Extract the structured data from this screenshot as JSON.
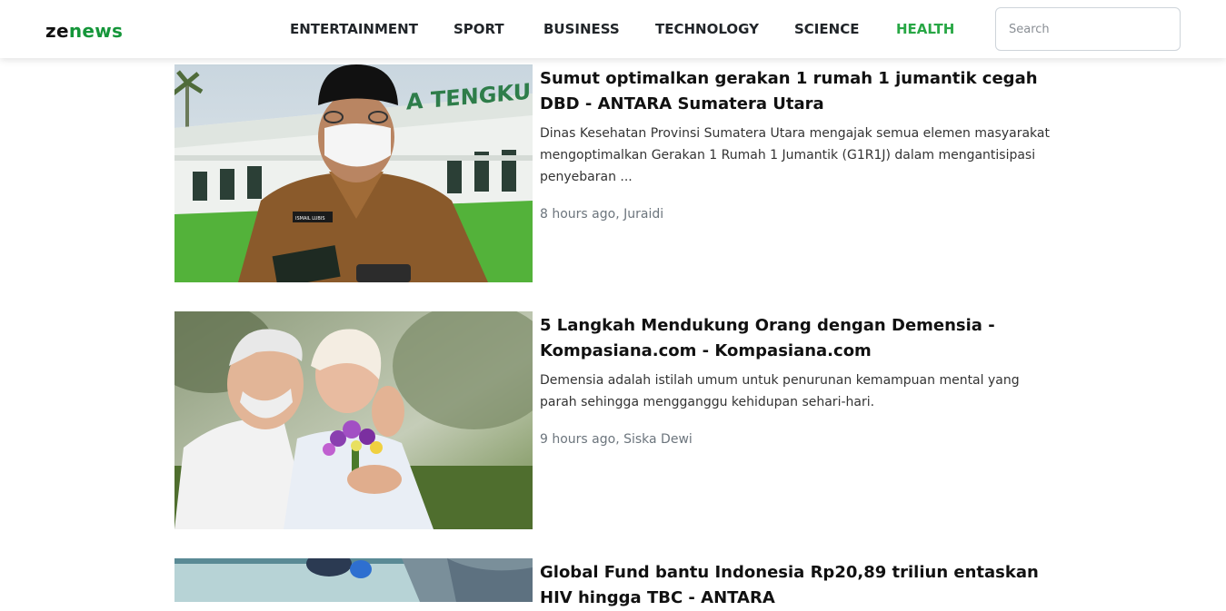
{
  "brand": {
    "part1": "ze",
    "part2": "news",
    "color_dark": "#111111",
    "color_accent": "#15963a"
  },
  "nav": {
    "items": [
      {
        "label": "ENTERTAINMENT",
        "active": false
      },
      {
        "label": "SPORT",
        "active": false
      },
      {
        "label": "BUSINESS",
        "active": false
      },
      {
        "label": "TECHNOLOGY",
        "active": false
      },
      {
        "label": "SCIENCE",
        "active": false
      },
      {
        "label": "HEALTH",
        "active": true
      }
    ],
    "active_color": "#28a745"
  },
  "search": {
    "placeholder": "Search",
    "value": ""
  },
  "articles": [
    {
      "title": "Sumut optimalkan gerakan 1 rumah 1 jumantik cegah DBD - ANTARA Sumatera Utara",
      "description": "Dinas Kesehatan Provinsi Sumatera Utara mengajak semua elemen masyarakat mengoptimalkan Gerakan 1 Rumah 1 Jumantik (G1R1J) dalam mengantisipasi penyebaran ...",
      "meta": "8 hours ago, Juraidi",
      "image": "photo-official-in-uniform-wearing-mask",
      "image_text": {
        "building_sign": "A TENGKU R",
        "name_tag": "ISMAIL LUBIS"
      }
    },
    {
      "title": "5 Langkah Mendukung Orang dengan Demensia - Kompasiana.com - Kompasiana.com",
      "description": "Demensia adalah istilah umum untuk penurunan kemampuan mental yang parah sehingga mengganggu kehidupan sehari-hari.",
      "meta": "9 hours ago, Siska Dewi",
      "image": "photo-elderly-couple-with-flowers"
    },
    {
      "title": "Global Fund bantu Indonesia Rp20,89 triliun entaskan HIV hingga TBC - ANTARA",
      "description": "",
      "meta": "",
      "image": "photo-health-worker"
    }
  ]
}
